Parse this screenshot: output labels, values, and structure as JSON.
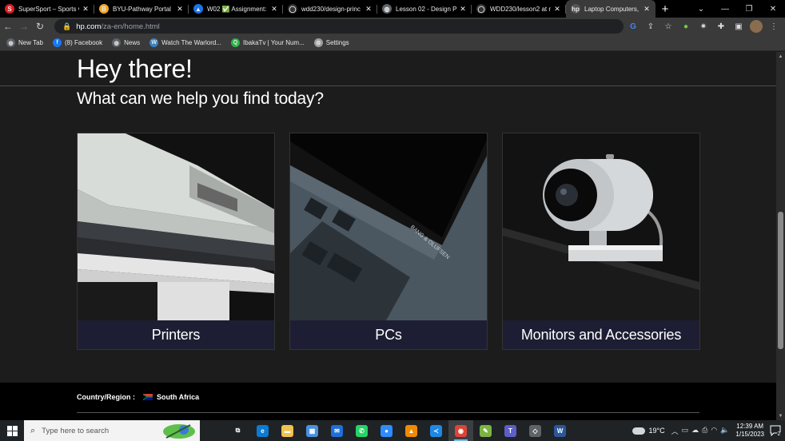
{
  "browser": {
    "tabs": [
      {
        "title": "SuperSport – Sports v",
        "favicon": "supersport-icon",
        "color": "#e21b23",
        "glyph": "S"
      },
      {
        "title": "BYU-Pathway Portal",
        "favicon": "byu-pathway-icon",
        "color": "#f5a623",
        "glyph": "B"
      },
      {
        "title": "W02 ✅ Assignment:",
        "favicon": "canvas-icon",
        "color": "#1a73e8",
        "glyph": "▲"
      },
      {
        "title": "wdd230/design-princ",
        "favicon": "github-icon",
        "color": "#333333",
        "glyph": "◯"
      },
      {
        "title": "Lesson 02 - Design Pr",
        "favicon": "globe-icon",
        "color": "#5f6368",
        "glyph": "◍"
      },
      {
        "title": "WDD230/lesson2 at m",
        "favicon": "github-icon",
        "color": "#333333",
        "glyph": "◯"
      },
      {
        "title": "Laptop Computers, D",
        "favicon": "hp-icon",
        "color": "#555555",
        "glyph": "hp"
      }
    ],
    "active_tab_index": 6,
    "new_tab_label": "+",
    "url_host": "hp.com",
    "url_path": "/za-en/home.html",
    "bookmarks": [
      {
        "label": "New Tab",
        "icon": "globe-icon",
        "color": "#5f6368",
        "glyph": "◍"
      },
      {
        "label": "(8) Facebook",
        "icon": "facebook-icon",
        "color": "#1877f2",
        "glyph": "f"
      },
      {
        "label": "News",
        "icon": "globe-icon",
        "color": "#5f6368",
        "glyph": "◍"
      },
      {
        "label": "Watch The Warlord...",
        "icon": "warlord-icon",
        "color": "#3b82c4",
        "glyph": "W"
      },
      {
        "label": "IbakaTv | Your Num...",
        "icon": "ibakatv-icon",
        "color": "#2db34a",
        "glyph": "Q"
      },
      {
        "label": "Settings",
        "icon": "gear-icon",
        "color": "#9e9e9e",
        "glyph": "⚙"
      }
    ]
  },
  "page": {
    "greeting": "Hey there!",
    "subtitle": "What can we help you find today?",
    "categories": [
      {
        "label": "Printers"
      },
      {
        "label": "PCs"
      },
      {
        "label": "Monitors and Accessories"
      }
    ],
    "footer": {
      "region_label": "Country/Region :",
      "region_value": "South Africa"
    }
  },
  "taskbar": {
    "search_placeholder": "Type here to search",
    "apps": [
      {
        "name": "task-view-icon",
        "color": "#1f2326",
        "glyph": "⧉"
      },
      {
        "name": "edge-icon",
        "color": "#0c7bd1",
        "glyph": "e"
      },
      {
        "name": "file-explorer-icon",
        "color": "#f2c14e",
        "glyph": "▬"
      },
      {
        "name": "ms-store-icon",
        "color": "#4a90e2",
        "glyph": "▦"
      },
      {
        "name": "mail-icon",
        "color": "#1e6fd9",
        "glyph": "✉"
      },
      {
        "name": "whatsapp-icon",
        "color": "#25d366",
        "glyph": "✆"
      },
      {
        "name": "zoom-icon",
        "color": "#2d8cff",
        "glyph": "●"
      },
      {
        "name": "vlc-icon",
        "color": "#f08a00",
        "glyph": "▲"
      },
      {
        "name": "vscode-icon",
        "color": "#1e88e5",
        "glyph": "≺"
      },
      {
        "name": "chrome-icon",
        "color": "#db4437",
        "glyph": "◉"
      },
      {
        "name": "notepad-plus-icon",
        "color": "#7cb342",
        "glyph": "✎"
      },
      {
        "name": "teams-icon",
        "color": "#5b5fc7",
        "glyph": "T"
      },
      {
        "name": "3d-viewer-icon",
        "color": "#5f6368",
        "glyph": "◇"
      },
      {
        "name": "word-icon",
        "color": "#2b579a",
        "glyph": "W"
      }
    ],
    "active_app_index": 9,
    "temperature": "19°C",
    "time": "12:39 AM",
    "date": "1/15/2023",
    "notification_count": "2"
  }
}
